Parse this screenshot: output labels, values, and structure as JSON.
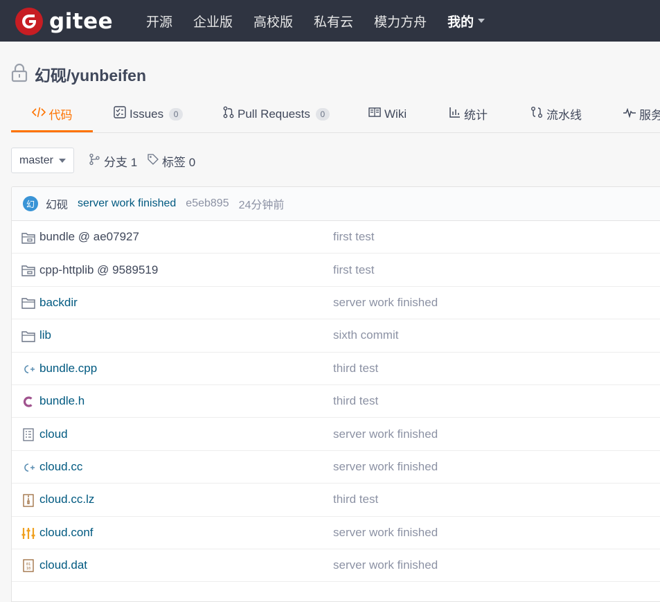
{
  "brand": {
    "name": "gitee",
    "color": "#c71d23"
  },
  "nav": {
    "items": [
      "开源",
      "企业版",
      "高校版",
      "私有云",
      "模力方舟"
    ],
    "mine": "我的"
  },
  "repo": {
    "name": "幻砚/yunbeifen"
  },
  "tabs": [
    {
      "label": "代码",
      "icon": "code-icon",
      "active": true
    },
    {
      "label": "Issues",
      "icon": "issues-icon",
      "count": "0"
    },
    {
      "label": "Pull Requests",
      "icon": "pull-request-icon",
      "count": "0"
    },
    {
      "label": "Wiki",
      "icon": "wiki-icon"
    },
    {
      "label": "统计",
      "icon": "stats-icon"
    },
    {
      "label": "流水线",
      "icon": "pipeline-icon"
    },
    {
      "label": "服务",
      "icon": "service-icon"
    }
  ],
  "branch": {
    "current": "master",
    "branches_label": "分支 1",
    "tags_label": "标签 0"
  },
  "commit": {
    "avatar_char": "幻",
    "author": "幻砚",
    "message": "server work finished",
    "sha": "e5eb895",
    "time": "24分钟前"
  },
  "files": [
    {
      "name": "bundle @ ae07927",
      "message": "first test",
      "icon": "submodule-icon",
      "linked": false
    },
    {
      "name": "cpp-httplib @ 9589519",
      "message": "first test",
      "icon": "submodule-icon",
      "linked": false
    },
    {
      "name": "backdir",
      "message": "server work finished",
      "icon": "folder-icon",
      "linked": true
    },
    {
      "name": "lib",
      "message": "sixth commit",
      "icon": "folder-icon",
      "linked": true
    },
    {
      "name": "bundle.cpp",
      "message": "third test",
      "icon": "cpp-file-icon",
      "linked": true
    },
    {
      "name": "bundle.h",
      "message": "third test",
      "icon": "c-header-icon",
      "linked": true
    },
    {
      "name": "cloud",
      "message": "server work finished",
      "icon": "text-file-icon",
      "linked": true
    },
    {
      "name": "cloud.cc",
      "message": "server work finished",
      "icon": "cpp-file-icon",
      "linked": true
    },
    {
      "name": "cloud.cc.lz",
      "message": "third test",
      "icon": "archive-file-icon",
      "linked": true
    },
    {
      "name": "cloud.conf",
      "message": "server work finished",
      "icon": "config-file-icon",
      "linked": true
    },
    {
      "name": "cloud.dat",
      "message": "server work finished",
      "icon": "binary-file-icon",
      "linked": true
    }
  ]
}
